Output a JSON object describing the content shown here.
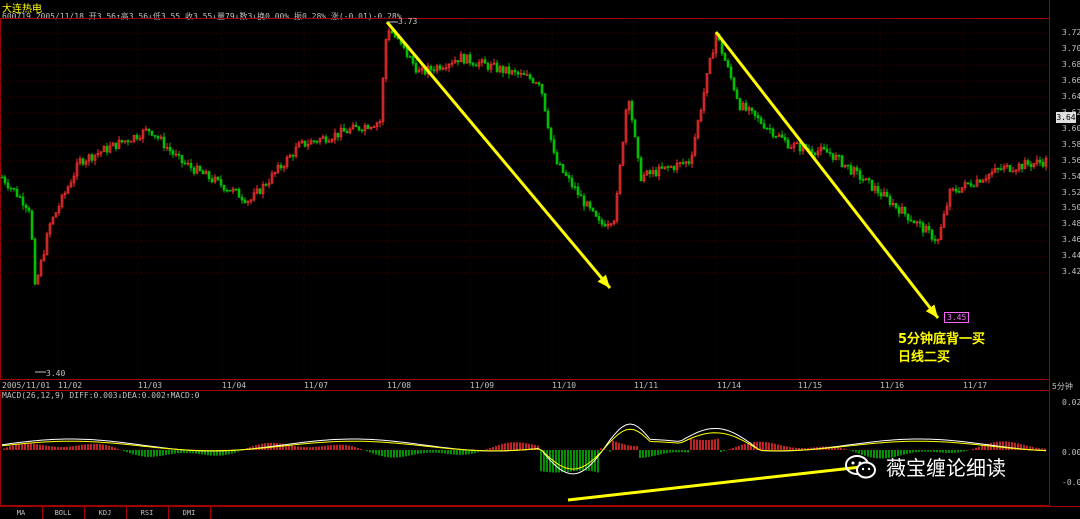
{
  "header": {
    "stock_name": "大连热电",
    "info_line": "600719 2005/11/18 开3.56↑高3.56↓低3.55 收3.55↓量79↓数3↓换0.00% 振0.28% 涨(-0.01)-0.28%"
  },
  "price_axis": {
    "labels": [
      "3.72",
      "3.70",
      "3.68",
      "3.66",
      "3.64",
      "3.62",
      "3.60",
      "3.58",
      "3.56",
      "3.54",
      "3.52",
      "3.50",
      "3.48",
      "3.46",
      "3.44",
      "3.42"
    ],
    "current_price": "3.64"
  },
  "date_axis": {
    "labels": [
      "2005/11/01",
      "11/02",
      "11/03",
      "11/04",
      "11/07",
      "11/08",
      "11/09",
      "11/10",
      "11/11",
      "11/14",
      "11/15",
      "11/16",
      "11/17"
    ],
    "period": "5分钟"
  },
  "markers": {
    "high": "3.73",
    "low": "3.40",
    "last_low": "3.45"
  },
  "macd": {
    "header": "MACD(26,12,9) DIFF:0.003↓DEA:0.002↑MACD:0",
    "axis_labels": [
      "0.02",
      "0.00",
      "-0.02"
    ],
    "colors": {
      "diff": "#ffffff",
      "dea": "#ffff00",
      "pos": "#ff3030",
      "neg": "#00c000"
    }
  },
  "tabs": [
    "MA",
    "BOLL",
    "KDJ",
    "RSI",
    "DMI"
  ],
  "annotations": {
    "line1": "5分钟底背一买",
    "line2": "日线二买"
  },
  "watermark": {
    "text": "薇宝缠论细读",
    "icon": "wechat-icon"
  },
  "colors": {
    "up": "#ff3030",
    "down": "#00c000",
    "arrow": "#ffff00",
    "frame": "#a00000"
  }
}
